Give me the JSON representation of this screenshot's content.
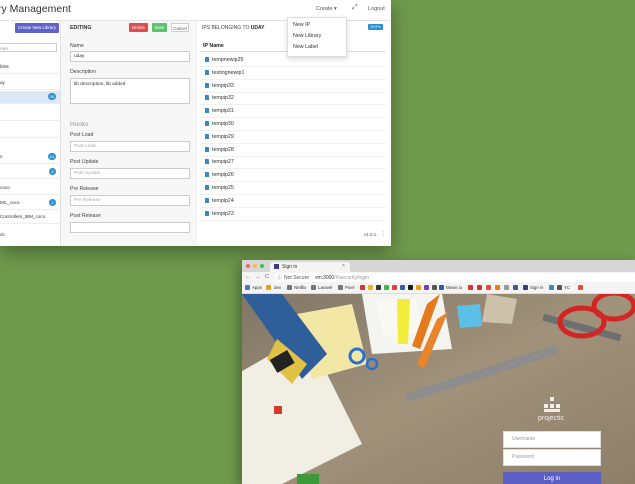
{
  "app": {
    "title": "ry Management",
    "create_menu": "Create ▾",
    "expand_icon": "expand-icon",
    "logout": "Logout",
    "create_dropdown": [
      "New IP",
      "New Library",
      "New Label"
    ]
  },
  "sidebar": {
    "create_library": "Create New Library",
    "search_placeholder": "rties",
    "items": [
      {
        "label": "bhi6",
        "badge": ""
      },
      {
        "label": "ay",
        "badge": ""
      },
      {
        "label": "",
        "badge": "28",
        "active": true
      },
      {
        "label": "",
        "badge": ""
      },
      {
        "label": "",
        "badge": ""
      },
      {
        "label": "n",
        "badge": "24"
      },
      {
        "label": "",
        "badge": "6"
      },
      {
        "label": "coco",
        "badge": ""
      },
      {
        "label": "MC_coco",
        "badge": "2"
      },
      {
        "label": "Controllers_IBM_coco",
        "badge": ""
      }
    ],
    "footer": "ds"
  },
  "editor": {
    "title": "EDITING",
    "delete": "Delete",
    "save": "Save",
    "cancel": "Cancel",
    "name_label": "Name",
    "name_value": "uday",
    "description_label": "Description",
    "description_value": "lib description, lib added",
    "hooks_title": "Hooks",
    "post_load_label": "Post Load",
    "post_load_placeholder": "Post Load",
    "post_update_label": "Post Update",
    "post_update_placeholder": "Post Update",
    "pre_release_label": "Pre Release",
    "pre_release_placeholder": "Pre Release",
    "post_release_label": "Post Release"
  },
  "ip_panel": {
    "header_prefix": "IPS BELONGING TO",
    "header_lib": "UDAY",
    "pill": "29 IPs",
    "column": "IP Name",
    "items": [
      "tempnewip25",
      "testingnewip1",
      "tempip33",
      "tempip32",
      "tempip31",
      "tempip30",
      "tempip29",
      "tempip28",
      "tempip27",
      "tempip26",
      "tempip25",
      "tempip24",
      "tempip23"
    ],
    "version": "v1.0.1"
  },
  "browser": {
    "tab_title": "Sign in",
    "url_prefix": "Not Secure",
    "url_host": "vm:3000",
    "url_path": "/#/security/login",
    "bookmarks": [
      "Apps",
      "dev",
      "Netflix",
      "Laravel",
      "Pixel",
      "Movie.io",
      "Sign in",
      "YC"
    ],
    "logo_text": "projectic",
    "username_placeholder": "Username",
    "password_placeholder": "Password",
    "login_button": "Log in"
  }
}
